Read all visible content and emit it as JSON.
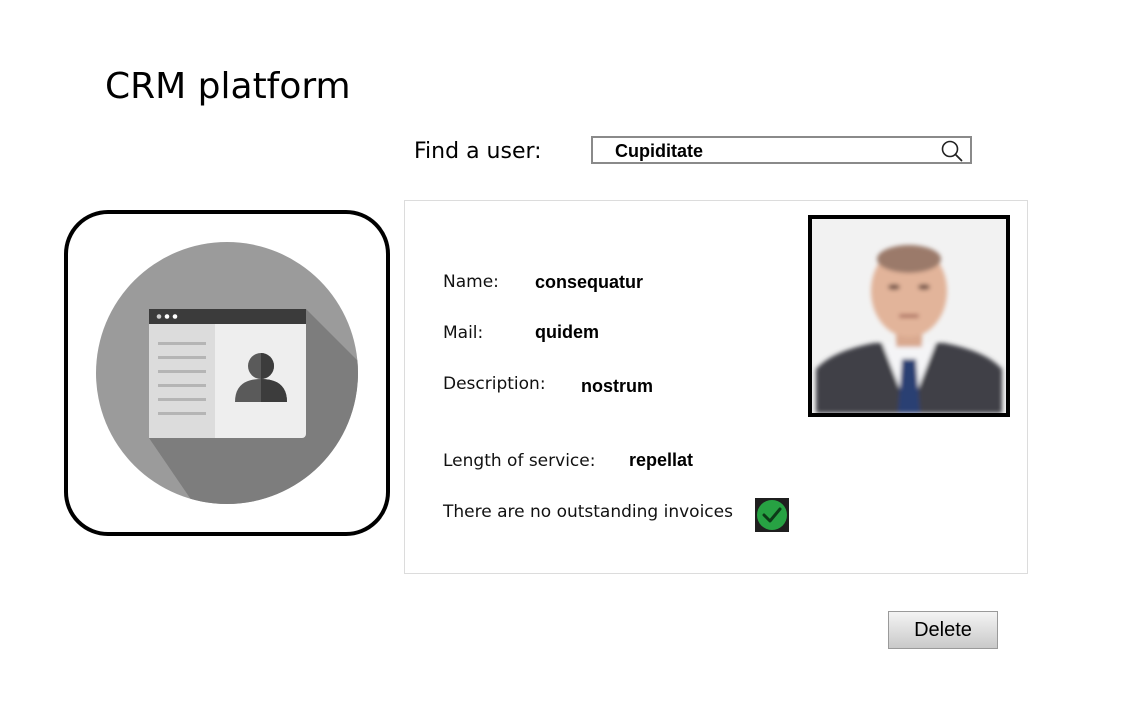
{
  "app": {
    "title": "CRM platform"
  },
  "search": {
    "label": "Find a user:",
    "value": "Cupiditate",
    "icon": "search-icon"
  },
  "details": {
    "name_label": "Name:",
    "name_value": "consequatur",
    "mail_label": "Mail:",
    "mail_value": "quidem",
    "description_label": "Description:",
    "description_value": "nostrum",
    "service_label": "Length of service:",
    "service_value": "repellat",
    "invoices_status": "There are no outstanding invoices",
    "invoices_icon": "check-icon"
  },
  "actions": {
    "delete_label": "Delete"
  },
  "colors": {
    "icon_circle": "#9b9b9b",
    "check_green": "#27a243"
  }
}
